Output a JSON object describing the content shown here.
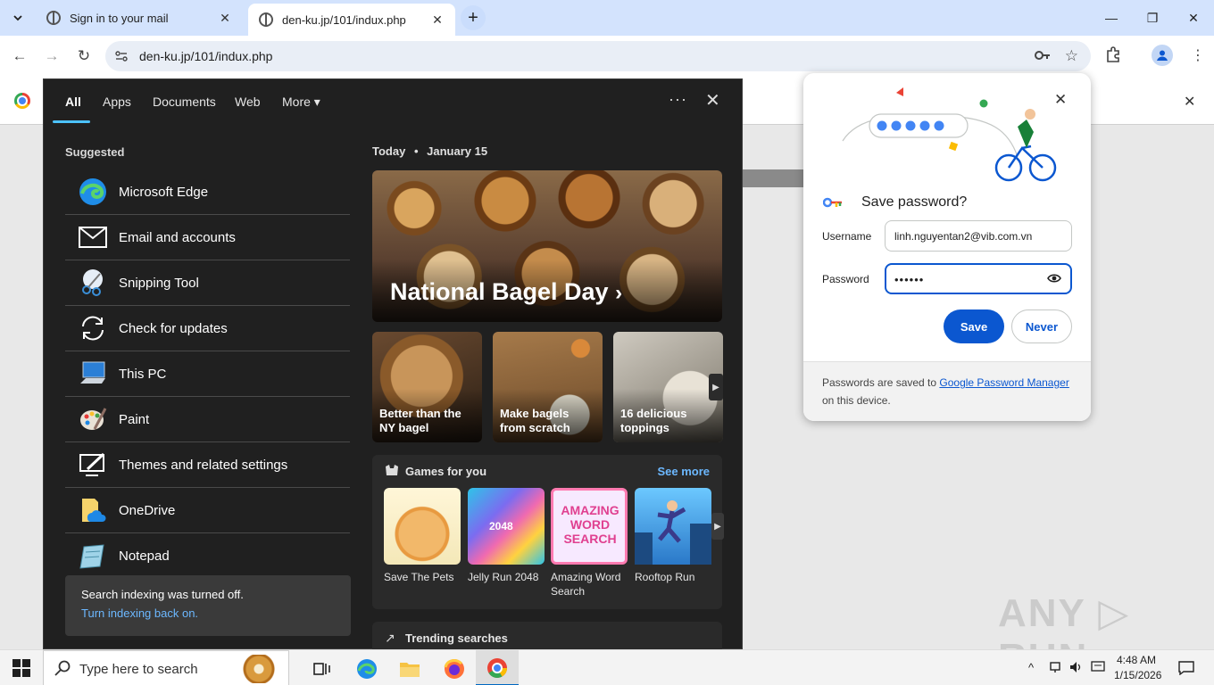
{
  "browser": {
    "tabs": [
      {
        "title": "Sign in to your mail",
        "close": "✕"
      },
      {
        "title": "den-ku.jp/101/indux.php",
        "close": "✕"
      }
    ],
    "new_tab": "+",
    "window_controls": {
      "minimize": "—",
      "maximize": "❐",
      "close": "✕"
    },
    "nav": {
      "back": "←",
      "forward": "→",
      "reload": "↻"
    },
    "address": "den-ku.jp/101/indux.php"
  },
  "start_flyout": {
    "tabs": [
      "All",
      "Apps",
      "Documents",
      "Web",
      "More"
    ],
    "more_caret": "▾",
    "dots": "···",
    "close": "✕",
    "suggested_title": "Suggested",
    "suggested": [
      {
        "label": "Microsoft Edge",
        "icon": "edge-icon"
      },
      {
        "label": "Email and accounts",
        "icon": "mail-icon"
      },
      {
        "label": "Snipping Tool",
        "icon": "snipping-tool-icon"
      },
      {
        "label": "Check for updates",
        "icon": "sync-icon"
      },
      {
        "label": "This PC",
        "icon": "computer-icon"
      },
      {
        "label": "Paint",
        "icon": "paint-icon"
      },
      {
        "label": "Themes and related settings",
        "icon": "themes-icon"
      },
      {
        "label": "OneDrive",
        "icon": "onedrive-icon"
      },
      {
        "label": "Notepad",
        "icon": "notepad-icon"
      }
    ],
    "notice": {
      "text": "Search indexing was turned off.",
      "link": "Turn indexing back on."
    },
    "today": {
      "label": "Today",
      "sep": "•",
      "date": "January 15"
    },
    "hero": {
      "title": "National Bagel Day",
      "chevron": "›"
    },
    "cards": [
      {
        "label": "Better than the NY bagel"
      },
      {
        "label": "Make bagels from scratch"
      },
      {
        "label": "16 delicious toppings"
      }
    ],
    "card_next": "▶",
    "games": {
      "title": "Games for you",
      "see_more": "See more",
      "items": [
        {
          "label": "Save The Pets"
        },
        {
          "label": "Jelly Run 2048"
        },
        {
          "label": "Amazing Word Search"
        },
        {
          "label": "Rooftop Run"
        }
      ],
      "thumb_text": {
        "jelly": "2048",
        "word": "AMAZING WORD SEARCH"
      },
      "next": "▶"
    },
    "trending": {
      "title": "Trending searches",
      "icon": "↗"
    }
  },
  "infobar": {
    "close": "✕"
  },
  "password_popup": {
    "title": "Save password?",
    "username_label": "Username",
    "username_value": "linh.nguyentan2@vib.com.vn",
    "password_label": "Password",
    "password_value": "••••••",
    "save": "Save",
    "never": "Never",
    "footer_prefix": "Passwords are saved to ",
    "footer_link": "Google Password Manager",
    "footer_suffix": " on this device.",
    "close": "✕"
  },
  "watermark": "ANY ▷ RUN",
  "taskbar": {
    "search_placeholder": "Type here to search",
    "clock_time": "4:48 AM",
    "clock_date": "1/15/2026"
  },
  "colors": {
    "accent": "#0b57d0",
    "flyout_bg": "#202020",
    "tab_strip": "#d3e3fd",
    "link_blue": "#6cb8ff"
  }
}
